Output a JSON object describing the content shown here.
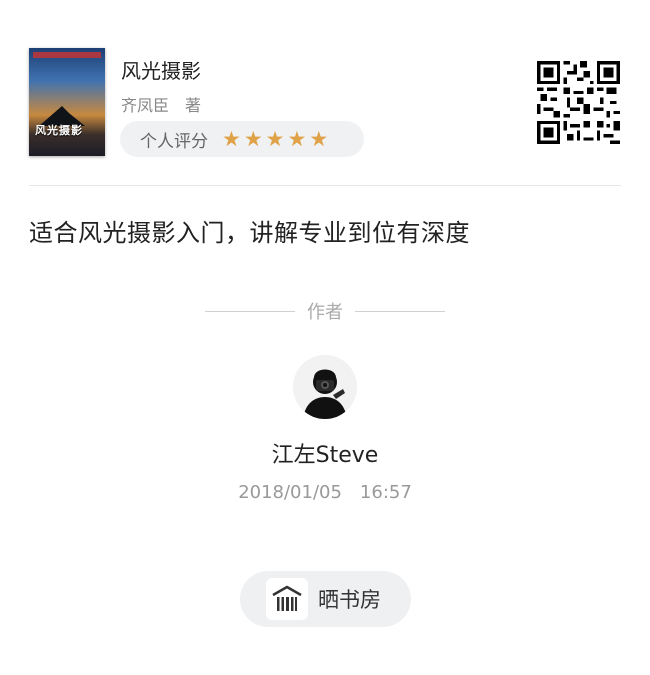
{
  "book": {
    "cover_title": "风光摄影",
    "title": "风光摄影",
    "author": "齐凤臣　著"
  },
  "rating": {
    "label": "个人评分",
    "stars": 5,
    "max_stars": 5,
    "star_color": "#e0a248"
  },
  "qr_icon": "qr-code-icon",
  "review": {
    "text": "适合风光摄影入门，讲解专业到位有深度"
  },
  "author_section": {
    "separator_label": "作者",
    "username": "江左Steve",
    "timestamp": "2018/01/05　16:57"
  },
  "share_button": {
    "label": "晒书房",
    "icon": "bookshelf-icon"
  }
}
